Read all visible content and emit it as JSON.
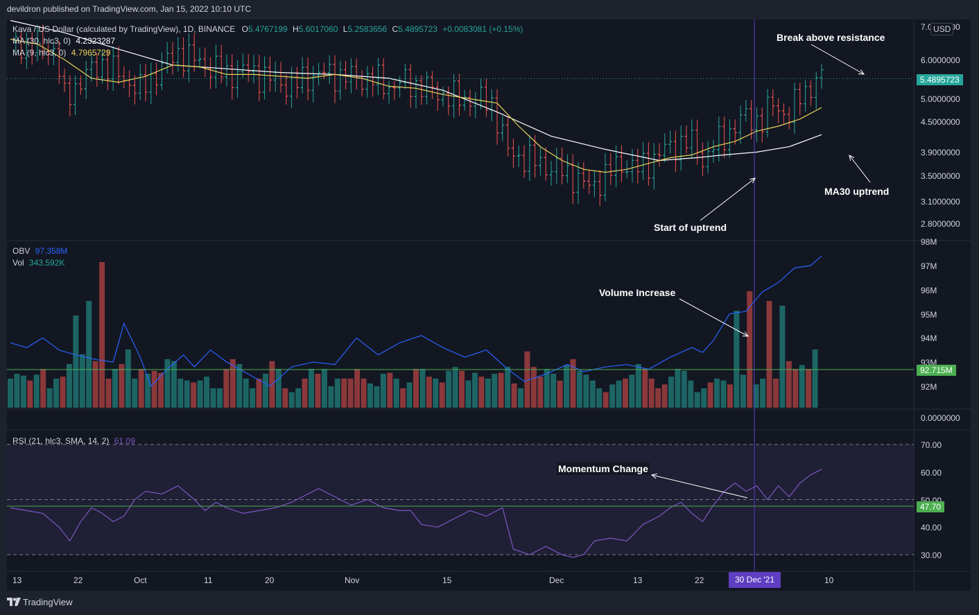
{
  "header": {
    "published": "devildron published on TradingView.com, Jan 15, 2022 10:10 UTC"
  },
  "footer": {
    "brand": "TradingView",
    "logo_icon": "tradingview-logo-icon"
  },
  "currency_button": "USD",
  "price_pane": {
    "symbol": "Kava / US Dollar (calculated by TradingView), 1D, BINANCE",
    "o_label": "O",
    "o": "5.4767199",
    "h_label": "H",
    "h": "5.6017060",
    "l_label": "L",
    "l": "5.2583656",
    "c_label": "C",
    "c": "5.4895723",
    "change": "+0.0083081 (+0.15%)",
    "ma30_label": "MA (30, hlc3, 0)",
    "ma30_value": "4.2323287",
    "ma9_label": "MA (9, hlc3, 0)",
    "ma9_value": "4.7965729",
    "last_price_tag": "5.4895723",
    "axis_labels": [
      "7.0000000",
      "6.0000000",
      "5.0000000",
      "4.5000000",
      "3.9000000",
      "3.5000000",
      "3.1000000",
      "2.8000000"
    ]
  },
  "volume_pane": {
    "obv_label": "OBV",
    "obv_value": "97.358M",
    "vol_label": "Vol",
    "vol_value": "343.592K",
    "obv_tag": "92.715M",
    "axis_labels": [
      "98M",
      "97M",
      "96M",
      "95M",
      "94M",
      "93M",
      "92M"
    ],
    "lower_axis_label": "0.0000000"
  },
  "rsi_pane": {
    "label": "RSI (21, hlc3, SMA, 14, 2)",
    "value": "61.09",
    "rsi_tag": "47.70",
    "axis_labels": [
      "70.00",
      "60.00",
      "50.00",
      "40.00",
      "30.00"
    ]
  },
  "time_axis": {
    "labels": [
      "13",
      "22",
      "Oct",
      "11",
      "20",
      "Nov",
      "15",
      "Dec",
      "13",
      "22",
      "10"
    ],
    "current": "30 Dec '21"
  },
  "annotations": {
    "break": "Break above resistance",
    "ma30": "MA30 uptrend",
    "start": "Start of uptrend",
    "volume": "Volume Increase",
    "momentum": "Momentum Change"
  },
  "colors": {
    "up": "#26a69a",
    "down": "#ef5350",
    "ma30": "#ffffff",
    "ma9": "#ebd35b",
    "obv": "#2962ff",
    "rsi": "#7e57c2",
    "price_line": "#26a69a",
    "hline": "#4caf50"
  },
  "chart_data": [
    {
      "type": "candlestick",
      "title": "Kava / US Dollar (calculated by TradingView), 1D, BINANCE",
      "x_start": "2021-09-12",
      "x_end": "2022-01-15",
      "y_scale": "log",
      "ylim": [
        2.7,
        7.1
      ],
      "close_path": [
        [
          0,
          6.5
        ],
        [
          5,
          6.4
        ],
        [
          8,
          6.3
        ],
        [
          10,
          5.0
        ],
        [
          12,
          5.3
        ],
        [
          15,
          5.7
        ],
        [
          17,
          5.9
        ],
        [
          20,
          5.6
        ],
        [
          24,
          5.2
        ],
        [
          28,
          5.8
        ],
        [
          31,
          6.2
        ],
        [
          34,
          6.0
        ],
        [
          37,
          5.8
        ],
        [
          40,
          5.6
        ],
        [
          44,
          5.7
        ],
        [
          48,
          5.5
        ],
        [
          52,
          5.3
        ],
        [
          56,
          5.6
        ],
        [
          60,
          5.6
        ],
        [
          64,
          5.5
        ],
        [
          67,
          5.5
        ],
        [
          70,
          5.3
        ],
        [
          73,
          5.4
        ],
        [
          76,
          5.3
        ],
        [
          80,
          5.1
        ],
        [
          83,
          5.0
        ],
        [
          86,
          5.0
        ],
        [
          89,
          4.9
        ],
        [
          92,
          3.9
        ],
        [
          95,
          3.8
        ],
        [
          98,
          3.7
        ],
        [
          101,
          3.6
        ],
        [
          104,
          3.5
        ],
        [
          107,
          3.3
        ],
        [
          110,
          3.5
        ],
        [
          113,
          3.7
        ],
        [
          116,
          3.6
        ],
        [
          119,
          3.8
        ],
        [
          122,
          4.0
        ],
        [
          125,
          4.1
        ],
        [
          127,
          4.0
        ],
        [
          128,
          3.75
        ],
        [
          130,
          4.0
        ],
        [
          133,
          4.3
        ],
        [
          136,
          4.6
        ],
        [
          139,
          4.5
        ],
        [
          141,
          4.9
        ],
        [
          144,
          4.6
        ],
        [
          146,
          5.1
        ],
        [
          148,
          5.3
        ],
        [
          150,
          5.4897
        ]
      ],
      "series": [
        {
          "name": "MA (30, hlc3, 0)",
          "path": [
            [
              0,
              7.2
            ],
            [
              10,
              6.8
            ],
            [
              20,
              6.3
            ],
            [
              30,
              5.85
            ],
            [
              40,
              5.75
            ],
            [
              50,
              5.65
            ],
            [
              60,
              5.6
            ],
            [
              70,
              5.5
            ],
            [
              80,
              5.2
            ],
            [
              90,
              4.7
            ],
            [
              100,
              4.2
            ],
            [
              110,
              3.95
            ],
            [
              120,
              3.75
            ],
            [
              127,
              3.8
            ],
            [
              132,
              3.85
            ],
            [
              138,
              3.9
            ],
            [
              144,
              4.0
            ],
            [
              150,
              4.23
            ]
          ]
        },
        {
          "name": "MA (9, hlc3, 0)",
          "path": [
            [
              0,
              6.6
            ],
            [
              5,
              6.45
            ],
            [
              10,
              6.0
            ],
            [
              15,
              5.5
            ],
            [
              20,
              5.4
            ],
            [
              25,
              5.55
            ],
            [
              30,
              5.85
            ],
            [
              35,
              5.8
            ],
            [
              40,
              5.6
            ],
            [
              45,
              5.6
            ],
            [
              50,
              5.55
            ],
            [
              55,
              5.5
            ],
            [
              60,
              5.6
            ],
            [
              65,
              5.5
            ],
            [
              70,
              5.3
            ],
            [
              75,
              5.25
            ],
            [
              80,
              5.1
            ],
            [
              85,
              5.0
            ],
            [
              90,
              4.9
            ],
            [
              94,
              4.4
            ],
            [
              98,
              4.0
            ],
            [
              102,
              3.75
            ],
            [
              106,
              3.6
            ],
            [
              110,
              3.55
            ],
            [
              114,
              3.6
            ],
            [
              118,
              3.7
            ],
            [
              122,
              3.8
            ],
            [
              126,
              3.85
            ],
            [
              130,
              4.0
            ],
            [
              134,
              4.1
            ],
            [
              138,
              4.3
            ],
            [
              142,
              4.4
            ],
            [
              146,
              4.55
            ],
            [
              150,
              4.8
            ]
          ]
        }
      ]
    },
    {
      "type": "bar",
      "title": "Vol",
      "bar_heights_hint": [
        30,
        35,
        33,
        28,
        34,
        40,
        20,
        30,
        32,
        45,
        95,
        55,
        110,
        48,
        150,
        30,
        40,
        45,
        60,
        30,
        40,
        35,
        38,
        36,
        50,
        48,
        30,
        28,
        26,
        28,
        32,
        20,
        20,
        40,
        50,
        45,
        30,
        20,
        30,
        35,
        48,
        40,
        20,
        16,
        20,
        30,
        40,
        35,
        40,
        22,
        30,
        30,
        30,
        40,
        30,
        25,
        22,
        35,
        36,
        30,
        20,
        26,
        40,
        40,
        32,
        30,
        26,
        38,
        42,
        38,
        28,
        36,
        32,
        30,
        35,
        36,
        42,
        25,
        20,
        58,
        42,
        32,
        40,
        35,
        28,
        44,
        50,
        38,
        34,
        28,
        20,
        16,
        24,
        28,
        30,
        34,
        45,
        40,
        30,
        20,
        24,
        32,
        40,
        38,
        28,
        16,
        20,
        26,
        30,
        28,
        24,
        100,
        34,
        120,
        24,
        30,
        110,
        30,
        105,
        48,
        40,
        44,
        40,
        60
      ],
      "bar_up_hint": [
        1,
        1,
        1,
        0,
        1,
        0,
        1,
        1,
        0,
        1,
        1,
        1,
        1,
        0,
        0,
        0,
        1,
        0,
        1,
        1,
        0,
        1,
        0,
        0,
        1,
        1,
        1,
        1,
        0,
        1,
        1,
        1,
        1,
        0,
        0,
        1,
        1,
        1,
        0,
        1,
        0,
        1,
        0,
        1,
        1,
        0,
        1,
        0,
        1,
        1,
        1,
        0,
        0,
        0,
        0,
        1,
        1,
        1,
        0,
        1,
        0,
        1,
        0,
        1,
        0,
        1,
        0,
        1,
        1,
        0,
        1,
        1,
        0,
        1,
        1,
        0,
        1,
        0,
        1,
        0,
        0,
        0,
        1,
        1,
        0,
        1,
        0,
        1,
        1,
        1,
        1,
        0,
        1,
        1,
        0,
        1,
        1,
        0,
        0,
        0,
        0,
        1,
        1,
        1,
        1,
        1,
        1,
        0,
        1,
        1,
        0,
        1,
        1,
        0,
        1,
        1,
        0,
        0,
        1,
        0,
        0,
        1,
        0,
        1
      ],
      "series": [
        {
          "name": "OBV",
          "path": [
            [
              0,
              93.8
            ],
            [
              3,
              93.6
            ],
            [
              6,
              94.0
            ],
            [
              9,
              93.5
            ],
            [
              12,
              93.3
            ],
            [
              16,
              93.1
            ],
            [
              19,
              93.0
            ],
            [
              21,
              94.6
            ],
            [
              24,
              93.2
            ],
            [
              26,
              92.0
            ],
            [
              29,
              92.7
            ],
            [
              32,
              93.3
            ],
            [
              34,
              92.8
            ],
            [
              37,
              93.5
            ],
            [
              40,
              93.0
            ],
            [
              44,
              92.5
            ],
            [
              48,
              92.0
            ],
            [
              52,
              92.8
            ],
            [
              56,
              93.0
            ],
            [
              60,
              92.9
            ],
            [
              64,
              94.0
            ],
            [
              68,
              93.3
            ],
            [
              72,
              93.8
            ],
            [
              76,
              94.1
            ],
            [
              80,
              93.6
            ],
            [
              84,
              93.2
            ],
            [
              88,
              93.5
            ],
            [
              92,
              92.7
            ],
            [
              95,
              92.2
            ],
            [
              99,
              92.5
            ],
            [
              103,
              92.9
            ],
            [
              106,
              92.6
            ],
            [
              110,
              92.8
            ],
            [
              114,
              92.9
            ],
            [
              118,
              92.7
            ],
            [
              122,
              93.2
            ],
            [
              126,
              93.6
            ],
            [
              128,
              93.4
            ],
            [
              130,
              93.9
            ],
            [
              133,
              95.0
            ],
            [
              136,
              95.1
            ],
            [
              139,
              95.9
            ],
            [
              142,
              96.3
            ],
            [
              145,
              96.9
            ],
            [
              148,
              97.0
            ],
            [
              150,
              97.4
            ]
          ]
        }
      ]
    },
    {
      "type": "line",
      "title": "RSI (21, hlc3, SMA, 14, 2)",
      "ylim": [
        25,
        75
      ],
      "series": [
        {
          "name": "RSI (21, hlc3, SMA, 14, 2)",
          "path": [
            [
              0,
              47
            ],
            [
              3,
              46
            ],
            [
              6,
              45
            ],
            [
              9,
              40
            ],
            [
              11,
              35
            ],
            [
              13,
              42
            ],
            [
              15,
              47
            ],
            [
              17,
              45
            ],
            [
              19,
              42
            ],
            [
              21,
              44
            ],
            [
              23,
              50
            ],
            [
              25,
              53
            ],
            [
              28,
              52
            ],
            [
              31,
              55
            ],
            [
              34,
              50
            ],
            [
              36,
              46
            ],
            [
              38,
              49
            ],
            [
              40,
              47
            ],
            [
              43,
              45
            ],
            [
              46,
              46
            ],
            [
              49,
              47
            ],
            [
              52,
              49
            ],
            [
              55,
              52
            ],
            [
              57,
              54
            ],
            [
              60,
              51
            ],
            [
              63,
              48
            ],
            [
              66,
              50
            ],
            [
              69,
              47
            ],
            [
              72,
              46
            ],
            [
              74,
              46
            ],
            [
              76,
              41
            ],
            [
              79,
              40
            ],
            [
              82,
              43
            ],
            [
              85,
              46
            ],
            [
              88,
              44
            ],
            [
              91,
              47
            ],
            [
              93,
              32
            ],
            [
              96,
              30
            ],
            [
              99,
              33
            ],
            [
              102,
              30
            ],
            [
              104,
              29
            ],
            [
              106,
              30
            ],
            [
              108,
              35
            ],
            [
              111,
              36
            ],
            [
              114,
              35
            ],
            [
              117,
              41
            ],
            [
              120,
              44
            ],
            [
              122,
              47
            ],
            [
              124,
              49
            ],
            [
              126,
              45
            ],
            [
              128,
              42
            ],
            [
              130,
              48
            ],
            [
              132,
              53
            ],
            [
              134,
              56
            ],
            [
              136,
              53
            ],
            [
              138,
              55
            ],
            [
              140,
              50
            ],
            [
              142,
              55
            ],
            [
              144,
              51
            ],
            [
              146,
              56
            ],
            [
              148,
              59
            ],
            [
              150,
              61
            ]
          ]
        }
      ]
    }
  ]
}
